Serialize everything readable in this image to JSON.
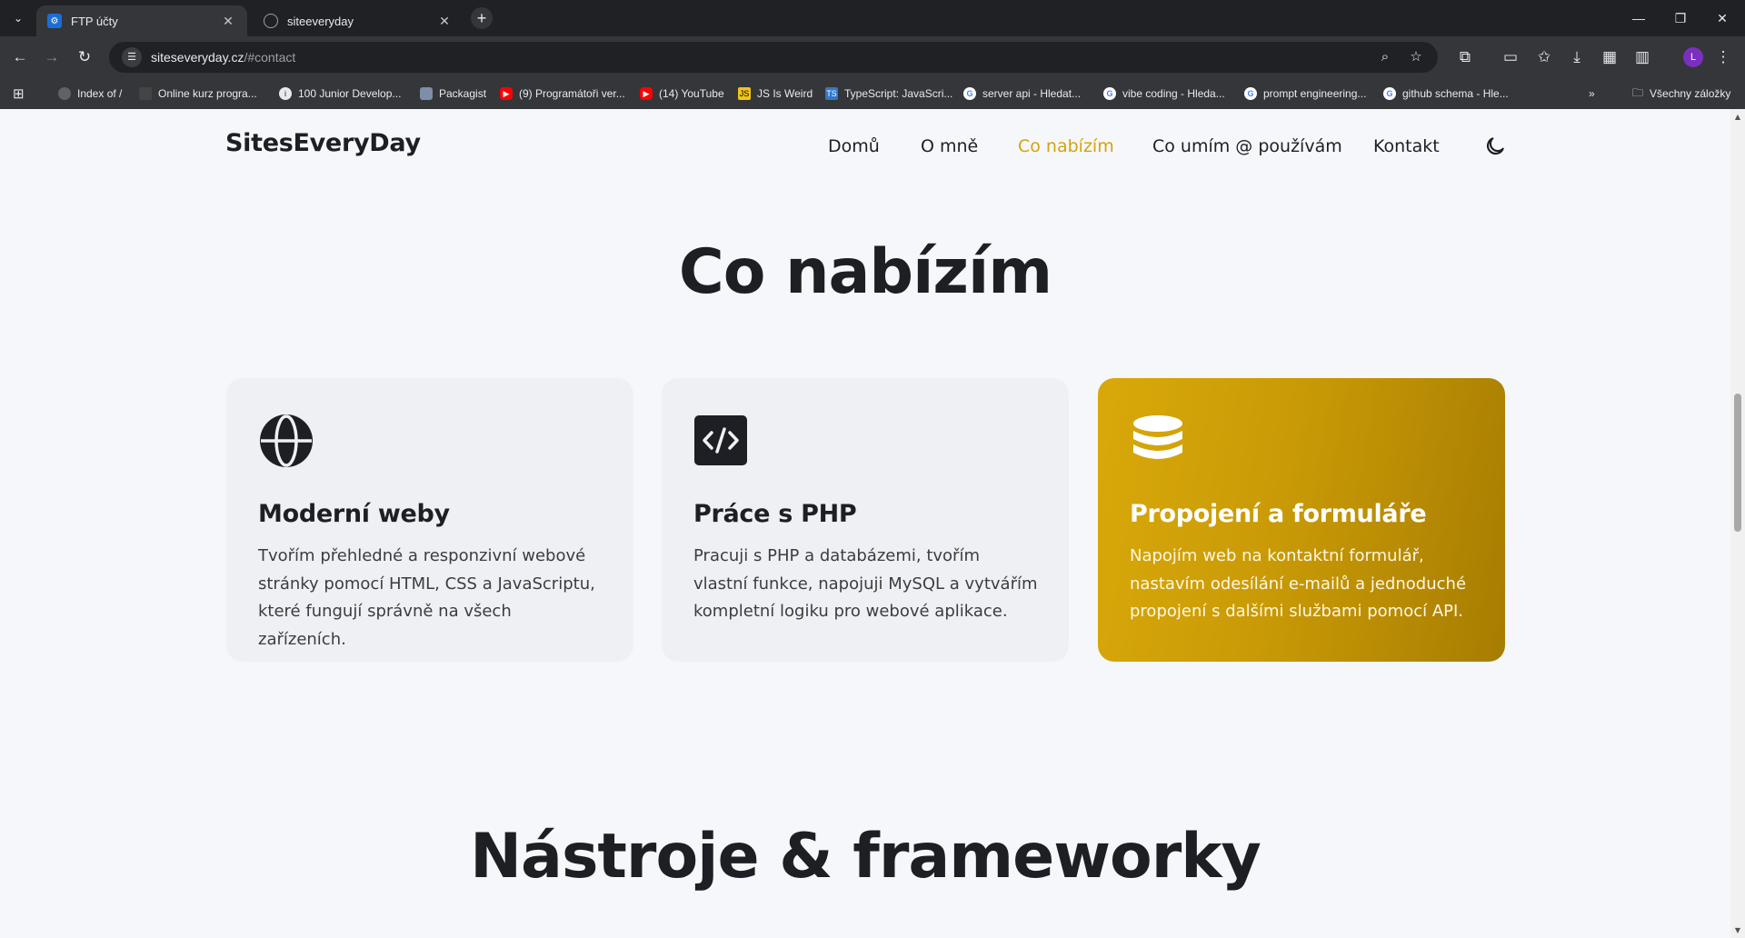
{
  "browser": {
    "tabs": [
      {
        "title": "FTP účty",
        "active": true
      },
      {
        "title": "siteeveryday",
        "active": false
      }
    ],
    "address": {
      "host": "siteseveryday.cz",
      "path": "/#contact"
    },
    "profile_initial": "L",
    "bookmarks": [
      {
        "label": "Index of /",
        "icon": "globe-icon"
      },
      {
        "label": "Online kurz progra...",
        "icon": "page-icon"
      },
      {
        "label": "100 Junior Develop...",
        "icon": "info-icon"
      },
      {
        "label": "Packagist",
        "icon": "packagist-icon"
      },
      {
        "label": "(9) Programátoři ver...",
        "icon": "youtube-icon"
      },
      {
        "label": "(14) YouTube",
        "icon": "youtube-icon"
      },
      {
        "label": "JS Is Weird",
        "icon": "js-icon"
      },
      {
        "label": "TypeScript: JavaScri...",
        "icon": "ts-icon"
      },
      {
        "label": "server api - Hledat...",
        "icon": "google-icon"
      },
      {
        "label": "vibe coding - Hleda...",
        "icon": "google-icon"
      },
      {
        "label": "prompt engineering...",
        "icon": "google-icon"
      },
      {
        "label": "github schema - Hle...",
        "icon": "google-icon"
      }
    ],
    "all_bookmarks_label": "Všechny záložky",
    "colors": {
      "chrome_dark": "#202124",
      "chrome_toolbar": "#35363a"
    }
  },
  "site": {
    "brand": "SitesEveryDay",
    "nav": [
      {
        "label": "Domů",
        "active": false
      },
      {
        "label": "O mně",
        "active": false
      },
      {
        "label": "Co nabízím",
        "active": true
      },
      {
        "label": "Co umím @ používám",
        "active": false
      },
      {
        "label": "Kontakt",
        "active": false
      }
    ],
    "theme_toggle_icon": "moon-icon",
    "services": {
      "heading": "Co nabízím",
      "cards": [
        {
          "icon": "globe-icon",
          "title": "Moderní weby",
          "text": "Tvořím přehledné a responzivní webové stránky pomocí HTML, CSS a JavaScriptu, které fungují správně na všech zařízeních.",
          "featured": false
        },
        {
          "icon": "code-icon",
          "title": "Práce s PHP",
          "text": "Pracuji s PHP a databázemi, tvořím vlastní funkce, napojuji MySQL a vytvářím kompletní logiku pro webové aplikace.",
          "featured": false
        },
        {
          "icon": "database-icon",
          "title": "Propojení a formuláře",
          "text": "Napojím web na kontaktní formulář, nastavím odesílání e-mailů a jednoduché propojení s dalšími službami pomocí API.",
          "featured": true
        }
      ]
    },
    "tools": {
      "heading": "Nástroje & frameworky"
    },
    "colors": {
      "accent": "#d4a40b",
      "text": "#1d1f24",
      "card_bg": "#eef0f4",
      "page_bg": "#f6f7fa"
    }
  }
}
